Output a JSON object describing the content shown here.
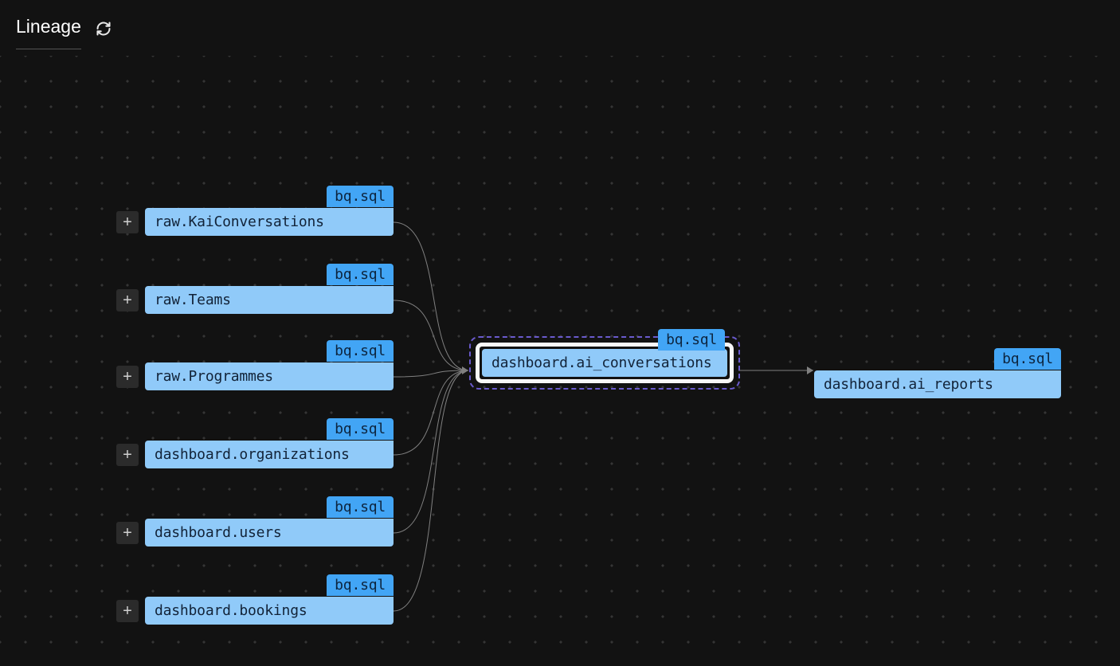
{
  "header": {
    "title": "Lineage"
  },
  "tag_label": "bq.sql",
  "nodes": {
    "n1": {
      "label": "raw.KaiConversations"
    },
    "n2": {
      "label": "raw.Teams"
    },
    "n3": {
      "label": "raw.Programmes"
    },
    "n4": {
      "label": "dashboard.organizations"
    },
    "n5": {
      "label": "dashboard.users"
    },
    "n6": {
      "label": "dashboard.bookings"
    },
    "center": {
      "label": "dashboard.ai_conversations"
    },
    "out": {
      "label": "dashboard.ai_reports"
    }
  }
}
